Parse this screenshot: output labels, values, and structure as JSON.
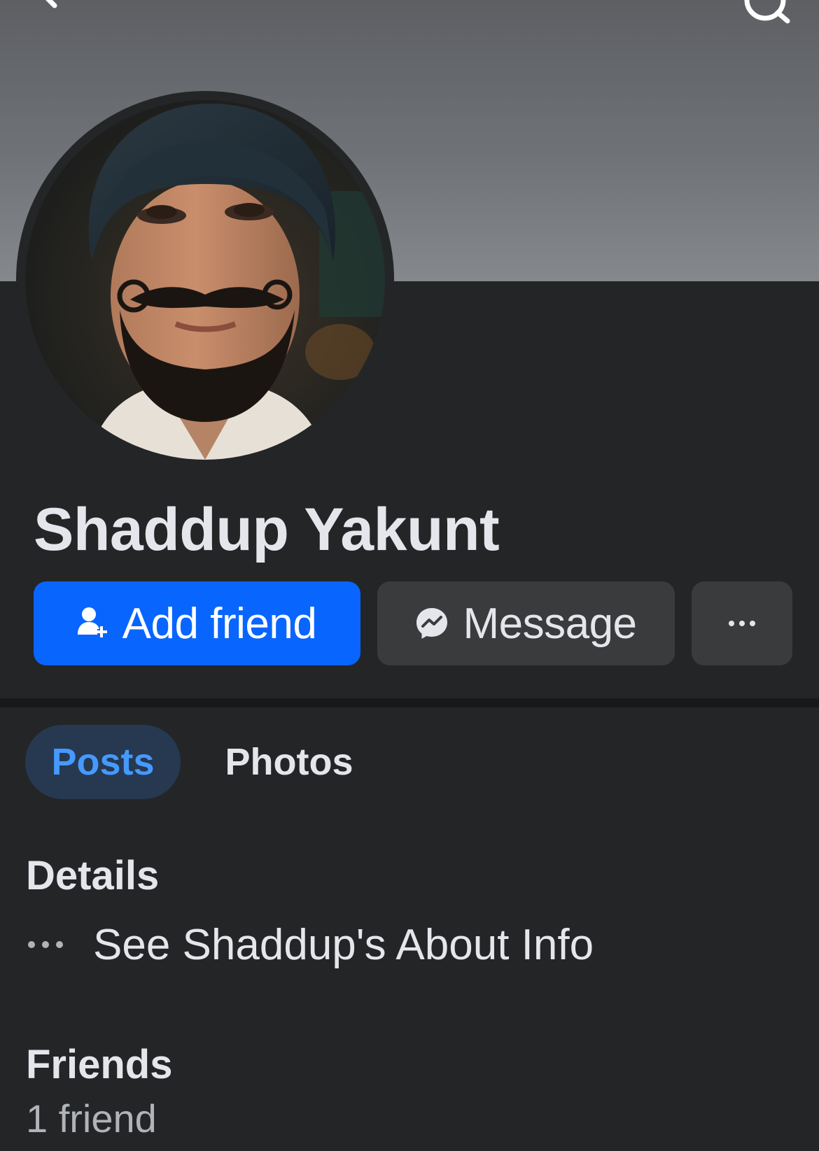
{
  "header": {
    "back_icon": "chevron-left-icon",
    "search_icon": "search-icon"
  },
  "profile": {
    "name": "Shaddup Yakunt",
    "avatar_description_icon": "profile-photo"
  },
  "actions": {
    "add_friend_label": "Add friend",
    "add_friend_icon": "add-person-icon",
    "message_label": "Message",
    "message_icon": "messenger-icon",
    "more_icon": "more-horizontal-icon"
  },
  "tabs": [
    {
      "label": "Posts",
      "selected": true
    },
    {
      "label": "Photos",
      "selected": false
    }
  ],
  "details": {
    "title": "Details",
    "about_label": "See Shaddup's About Info",
    "about_icon": "more-dots-icon"
  },
  "friends": {
    "title": "Friends",
    "count_label": "1 friend"
  },
  "colors": {
    "background": "#242527",
    "primary_button": "#0866ff",
    "secondary_button": "#3a3b3c",
    "selected_tab_bg": "#263951",
    "selected_tab_text": "#4599ff",
    "text_primary": "#e4e6eb",
    "text_secondary": "#b0b3b8"
  }
}
